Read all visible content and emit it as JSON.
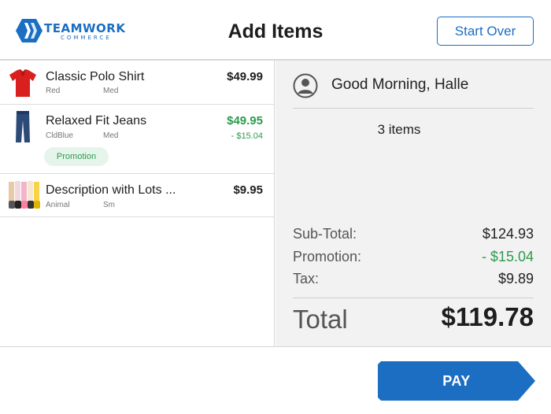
{
  "header": {
    "logo_line1": "TEAMWORK",
    "logo_line2": "COMMERCE",
    "title": "Add Items",
    "start_over_label": "Start Over"
  },
  "items": [
    {
      "name": "Classic Polo Shirt",
      "attr1": "Red",
      "attr2": "Med",
      "price": "$49.99",
      "discount": "",
      "badge": "",
      "thumb": "red-polo-shirt-image"
    },
    {
      "name": "Relaxed Fit Jeans",
      "attr1": "CldBlue",
      "attr2": "Med",
      "price": "$49.95",
      "discount": "- $15.04",
      "badge": "Promotion",
      "thumb": "blue-jeans-image"
    },
    {
      "name": "Description with Lots ...",
      "attr1": "Animal",
      "attr2": "Sm",
      "price": "$9.95",
      "discount": "",
      "badge": "",
      "thumb": "socks-image"
    }
  ],
  "summary": {
    "greeting": "Good Morning, Halle",
    "item_count": "3 items",
    "subtotal_label": "Sub-Total:",
    "subtotal_value": "$124.93",
    "promotion_label": "Promotion:",
    "promotion_value": "- $15.04",
    "tax_label": "Tax:",
    "tax_value": "$9.89",
    "total_label": "Total",
    "total_value": "$119.78"
  },
  "footer": {
    "pay_label": "PAY"
  },
  "colors": {
    "accent": "#1b6ec2",
    "promo_green": "#2e9a4c",
    "panel_bg": "#f2f2f2"
  }
}
